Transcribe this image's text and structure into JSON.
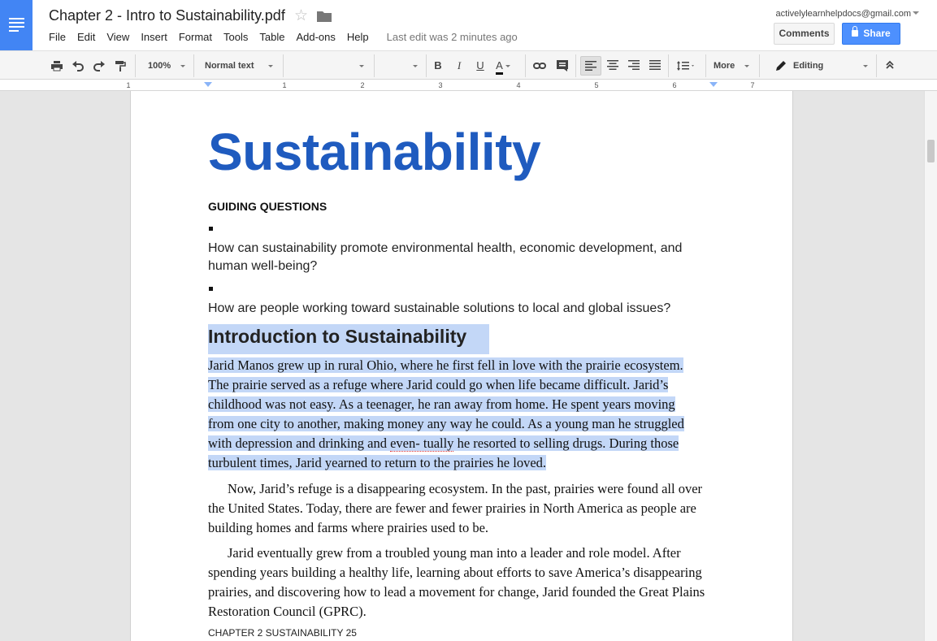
{
  "header": {
    "doc_title": "Chapter 2 - Intro to Sustainability.pdf",
    "menu": [
      "File",
      "Edit",
      "View",
      "Insert",
      "Format",
      "Tools",
      "Table",
      "Add-ons",
      "Help"
    ],
    "last_edit": "Last edit was 2 minutes ago",
    "account": "activelylearnhelpdocs@gmail.com",
    "comments_label": "Comments",
    "share_label": "Share"
  },
  "toolbar": {
    "zoom": "100%",
    "style": "Normal text",
    "font": "",
    "font_size": "",
    "bold": "B",
    "italic": "I",
    "underline": "U",
    "text_color": "A",
    "more_label": "More",
    "mode_label": "Editing"
  },
  "ruler": {
    "ticks": [
      "1",
      "1",
      "2",
      "3",
      "4",
      "5",
      "6",
      "7"
    ]
  },
  "document": {
    "heading": "Sustainability",
    "guiding_title": "GUIDING QUESTIONS",
    "questions": [
      "How can sustainability promote environmental health, economic development, and human well-being?",
      "How are people working toward sustainable solutions to local and global issues?"
    ],
    "intro_heading": "Introduction to Sustainability",
    "para1_lines": [
      "Jarid Manos grew up in rural Ohio, where he first fell in love with the prairie ecosystem.",
      "The prairie served as a refuge where Jarid could go when life became difficult. Jarid’s",
      "childhood was not easy. As a teenager, he ran away from home. He spent years moving",
      "from one city to another, making money any way he could. As a young man he struggled",
      "with depression and drinking and",
      "even- tually",
      "he resorted to selling drugs. During those",
      "turbulent times, Jarid yearned to return to the prairies he loved."
    ],
    "para2": "Now, Jarid’s refuge is a disappearing ecosystem. In the past, prairies were found all over the United States. Today, there are fewer and fewer prairies in North America as people are building homes and farms where prairies used to be.",
    "para3": "Jarid eventually grew from a troubled young man into a leader and role model. After spending years building a healthy life, learning about efforts to save America’s disappearing prairies, and discovering how to lead a movement for change, Jarid founded the Great Plains Restoration Council (GPRC).",
    "footer": "CHAPTER 2 SUSTAINABILITY 25"
  }
}
